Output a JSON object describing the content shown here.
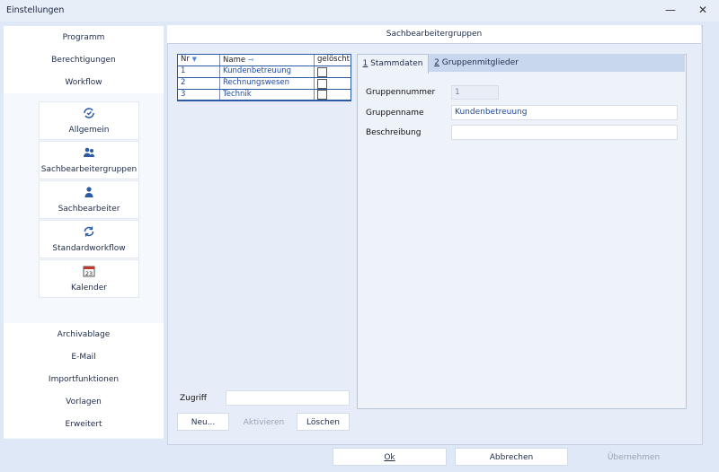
{
  "window": {
    "title": "Einstellungen",
    "minimize": "—",
    "close": "✕"
  },
  "sidebar": {
    "top_items": [
      {
        "label": "Programm"
      },
      {
        "label": "Berechtigungen"
      },
      {
        "label": "Workflow"
      }
    ],
    "tiles": [
      {
        "label": "Allgemein",
        "icon": "refresh-check-icon"
      },
      {
        "label": "Sachbearbeitergruppen",
        "icon": "users-icon"
      },
      {
        "label": "Sachbearbeiter",
        "icon": "user-icon"
      },
      {
        "label": "Standardworkflow",
        "icon": "cycle-icon"
      },
      {
        "label": "Kalender",
        "icon": "calendar-icon",
        "day": "23"
      }
    ],
    "bottom_items": [
      {
        "label": "Archivablage"
      },
      {
        "label": "E-Mail"
      },
      {
        "label": "Importfunktionen"
      },
      {
        "label": "Vorlagen"
      },
      {
        "label": "Erweitert"
      }
    ]
  },
  "main": {
    "header": "Sachbearbeitergruppen",
    "grid": {
      "columns": [
        "Nr",
        "Name",
        "gelöscht"
      ],
      "rows": [
        {
          "nr": "1",
          "name": "Kundenbetreuung"
        },
        {
          "nr": "2",
          "name": "Rechnungswesen"
        },
        {
          "nr": "3",
          "name": "Technik"
        }
      ]
    },
    "tabs": [
      {
        "key": "1",
        "label": " Stammdaten"
      },
      {
        "key": "2",
        "label": " Gruppenmitglieder"
      }
    ],
    "form": {
      "gruppennummer_label": "Gruppennummer",
      "gruppennummer_value": "1",
      "gruppenname_label": "Gruppenname",
      "gruppenname_value": "Kundenbetreuung",
      "beschreibung_label": "Beschreibung",
      "beschreibung_value": ""
    },
    "zugriff_label": "Zugriff",
    "zugriff_value": "",
    "buttons": {
      "neu": "Neu...",
      "aktivieren": "Aktivieren",
      "loeschen": "Löschen"
    }
  },
  "footer": {
    "ok": "Ok",
    "abbrechen": "Abbrechen",
    "uebernehmen": "Übernehmen"
  },
  "colors": {
    "accent": "#2b5aa6",
    "background": "#dfe8f6"
  }
}
